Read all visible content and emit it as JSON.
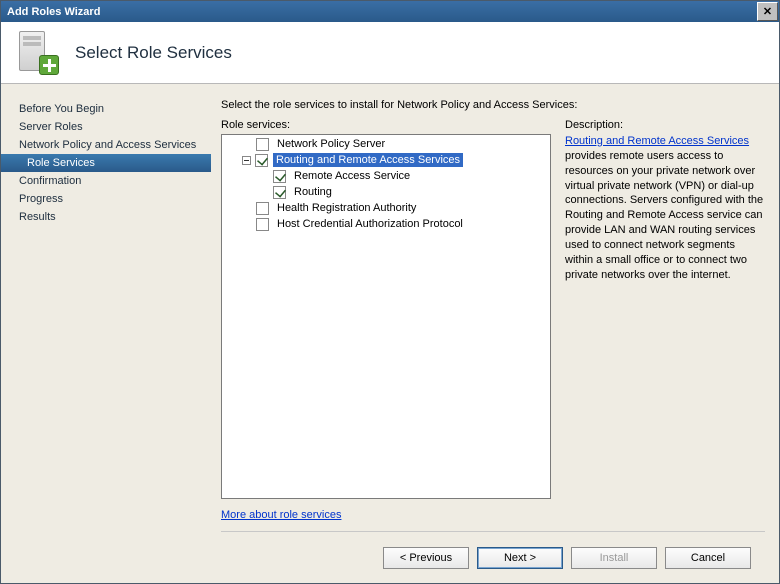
{
  "window": {
    "title": "Add Roles Wizard"
  },
  "header": {
    "title": "Select Role Services"
  },
  "sidebar": {
    "items": [
      {
        "label": "Before You Begin",
        "selected": false
      },
      {
        "label": "Server Roles",
        "selected": false
      },
      {
        "label": "Network Policy and Access Services",
        "selected": false
      },
      {
        "label": "Role Services",
        "selected": true
      },
      {
        "label": "Confirmation",
        "selected": false
      },
      {
        "label": "Progress",
        "selected": false
      },
      {
        "label": "Results",
        "selected": false
      }
    ]
  },
  "main": {
    "instruction": "Select the role services to install for Network Policy and Access Services:",
    "role_services_label": "Role services:",
    "tree": [
      {
        "indent": 34,
        "twisty": false,
        "checked": false,
        "label": "Network Policy Server",
        "highlight": false
      },
      {
        "indent": 20,
        "twisty": true,
        "checked": true,
        "label": "Routing and Remote Access Services",
        "highlight": true
      },
      {
        "indent": 51,
        "twisty": false,
        "checked": true,
        "label": "Remote Access Service",
        "highlight": false
      },
      {
        "indent": 51,
        "twisty": false,
        "checked": true,
        "label": "Routing",
        "highlight": false
      },
      {
        "indent": 34,
        "twisty": false,
        "checked": false,
        "label": "Health Registration Authority",
        "highlight": false
      },
      {
        "indent": 34,
        "twisty": false,
        "checked": false,
        "label": "Host Credential Authorization Protocol",
        "highlight": false
      }
    ],
    "more_link": "More about role services",
    "description_label": "Description:",
    "description_link": "Routing and Remote Access Services",
    "description_body": " provides remote users access to resources on your private network over virtual private network (VPN) or dial-up connections. Servers configured with the Routing and Remote Access service can provide LAN and WAN routing services used to connect network segments within a small office or to connect two private networks over the internet."
  },
  "buttons": {
    "previous": "< Previous",
    "next": "Next >",
    "install": "Install",
    "cancel": "Cancel"
  }
}
